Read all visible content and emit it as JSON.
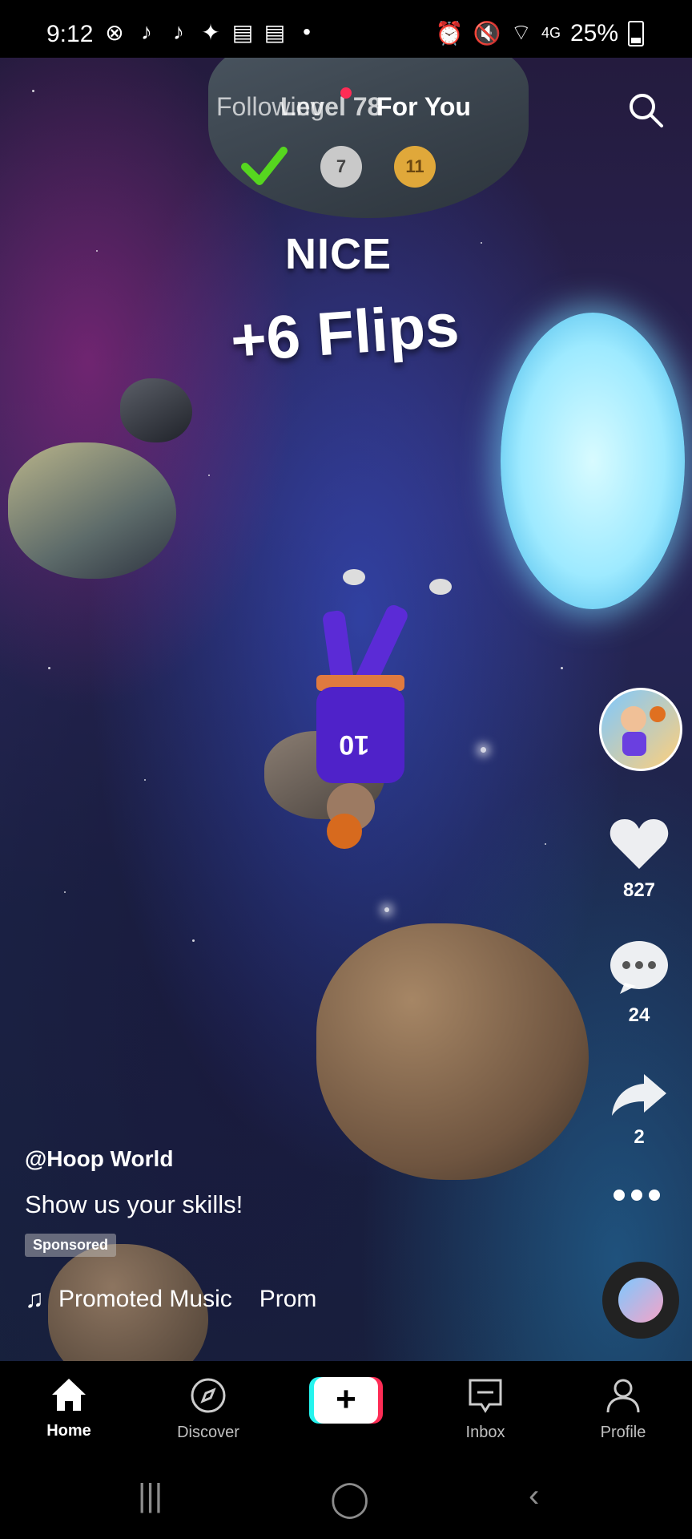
{
  "status_bar": {
    "time": "9:12",
    "app_icons": [
      "xbox-icon",
      "tiktok-icon",
      "tiktok-icon",
      "twitter-icon",
      "news-icon",
      "news-icon",
      "dot"
    ],
    "network": "4G",
    "battery": "25%"
  },
  "top_nav": {
    "following": "Following",
    "level_overlay": "Level 78",
    "for_you": "For You"
  },
  "game": {
    "hud_coins": [
      "7",
      "11"
    ],
    "nice": "NICE",
    "flips": "+6 Flips",
    "jersey_number": "10"
  },
  "actions": {
    "likes": "827",
    "comments": "24",
    "shares": "2"
  },
  "post": {
    "username": "@Hoop World",
    "caption": "Show us your skills!",
    "sponsored": "Sponsored",
    "music": "Promoted Music",
    "music_scroll": "Prom"
  },
  "bottom_nav": {
    "home": "Home",
    "discover": "Discover",
    "inbox": "Inbox",
    "profile": "Profile",
    "create": "+"
  },
  "colors": {
    "accent_pink": "#fe2c55",
    "accent_cyan": "#25f4ee"
  }
}
